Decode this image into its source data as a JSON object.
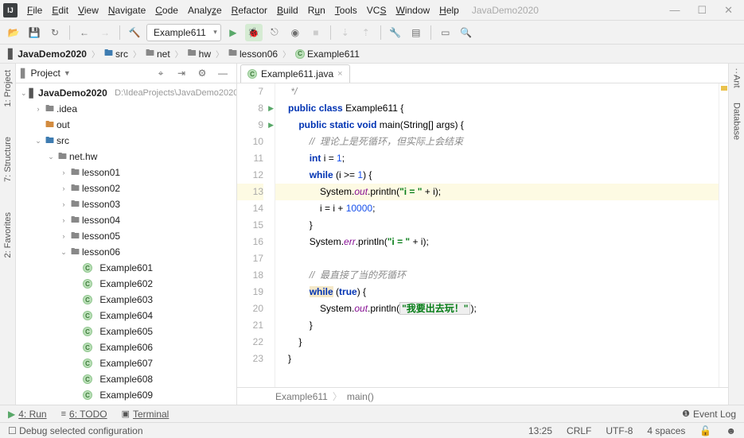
{
  "app_name": "JavaDemo2020",
  "menu": [
    "File",
    "Edit",
    "View",
    "Navigate",
    "Code",
    "Analyze",
    "Refactor",
    "Build",
    "Run",
    "Tools",
    "VCS",
    "Window",
    "Help"
  ],
  "run_config": "Example611",
  "breadcrumb": [
    {
      "icon": "project",
      "label": "JavaDemo2020"
    },
    {
      "icon": "folder",
      "label": "src"
    },
    {
      "icon": "folder",
      "label": "net"
    },
    {
      "icon": "folder",
      "label": "hw"
    },
    {
      "icon": "folder",
      "label": "lesson06"
    },
    {
      "icon": "class",
      "label": "Example611"
    }
  ],
  "project_panel": {
    "title": "Project"
  },
  "tree": {
    "root": "JavaDemo2020",
    "root_path": "D:\\IdeaProjects\\JavaDemo2020",
    "idea": ".idea",
    "out": "out",
    "src": "src",
    "pkg": "net.hw",
    "lessons": [
      "lesson01",
      "lesson02",
      "lesson03",
      "lesson04",
      "lesson05",
      "lesson06"
    ],
    "examples": [
      "Example601",
      "Example602",
      "Example603",
      "Example604",
      "Example605",
      "Example606",
      "Example607",
      "Example608",
      "Example609"
    ]
  },
  "editor_tab": "Example611.java",
  "code": {
    "l7": "*/",
    "l8a": "public",
    "l8b": "class",
    "l8c": "Example611 {",
    "l9a": "public",
    "l9b": "static",
    "l9c": "void",
    "l9d": "main(String[] args) {",
    "l10": "//  理论上是死循环，但实际上会结束",
    "l11a": "int",
    "l11b": "i = ",
    "l11c": "1",
    "l11d": ";",
    "l12a": "while",
    "l12b": " (i >= ",
    "l12c": "1",
    "l12d": ") {",
    "l13a": "System.",
    "l13b": "out",
    "l13c": ".println(",
    "l13d": "\"i = \"",
    "l13e": " + i);",
    "l14a": "i = i + ",
    "l14b": "10000",
    "l14c": ";",
    "l15": "}",
    "l16a": "System.",
    "l16b": "err",
    "l16c": ".println(",
    "l16d": "\"i = \"",
    "l16e": " + i);",
    "l18": "//  最直接了当的死循环",
    "l19a": "while",
    "l19b": " (",
    "l19c": "true",
    "l19d": ") {",
    "l20a": "System.",
    "l20b": "out",
    "l20c": ".println(",
    "l20d": "\"我要出去玩！\"",
    "l20e": ");",
    "l21": "}",
    "l22": "}",
    "l23": "}"
  },
  "crumbs": {
    "class": "Example611",
    "method": "main()"
  },
  "bottom": {
    "run": "4: Run",
    "todo": "6: TODO",
    "terminal": "Terminal",
    "event": "Event Log"
  },
  "status": {
    "hint": "Debug selected configuration",
    "pos": "13:25",
    "eol": "CRLF",
    "enc": "UTF-8",
    "indent": "4 spaces"
  },
  "left_tools": [
    "1: Project",
    "7: Structure",
    "2: Favorites"
  ],
  "right_tools": [
    "Ant",
    "Database"
  ]
}
